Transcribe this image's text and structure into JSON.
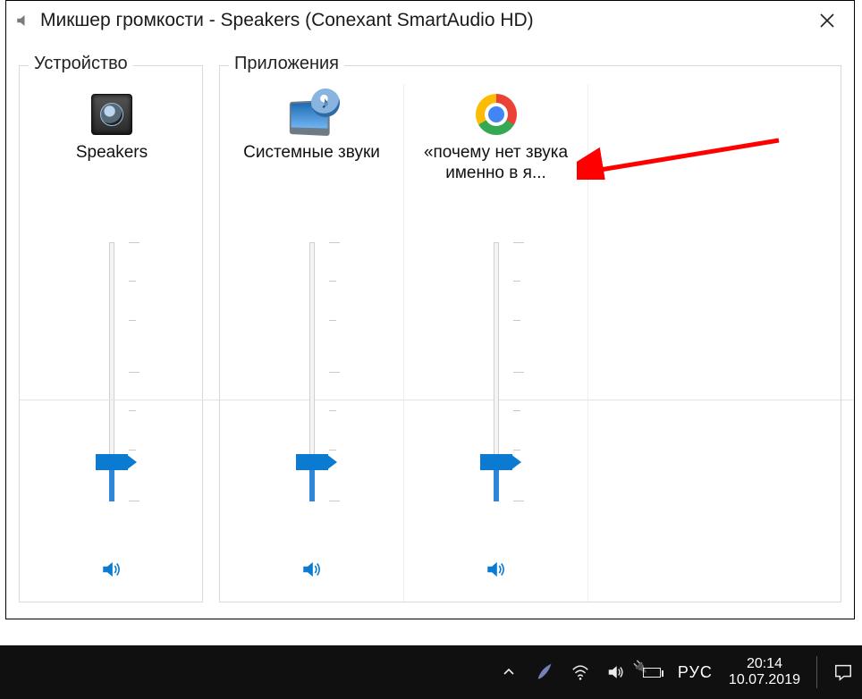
{
  "window": {
    "title": "Микшер громкости - Speakers (Conexant SmartAudio HD)"
  },
  "groups": {
    "device": "Устройство",
    "apps": "Приложения"
  },
  "mixer": {
    "device": {
      "label": "Speakers",
      "level": 15,
      "icon": "speaker-device"
    },
    "apps": [
      {
        "label": "Системные звуки",
        "level": 15,
        "icon": "system-sounds"
      },
      {
        "label": "«почему нет звука именно в я...",
        "level": 15,
        "icon": "chrome"
      }
    ]
  },
  "taskbar": {
    "lang": "РУС",
    "time": "20:14",
    "date": "10.07.2019"
  }
}
